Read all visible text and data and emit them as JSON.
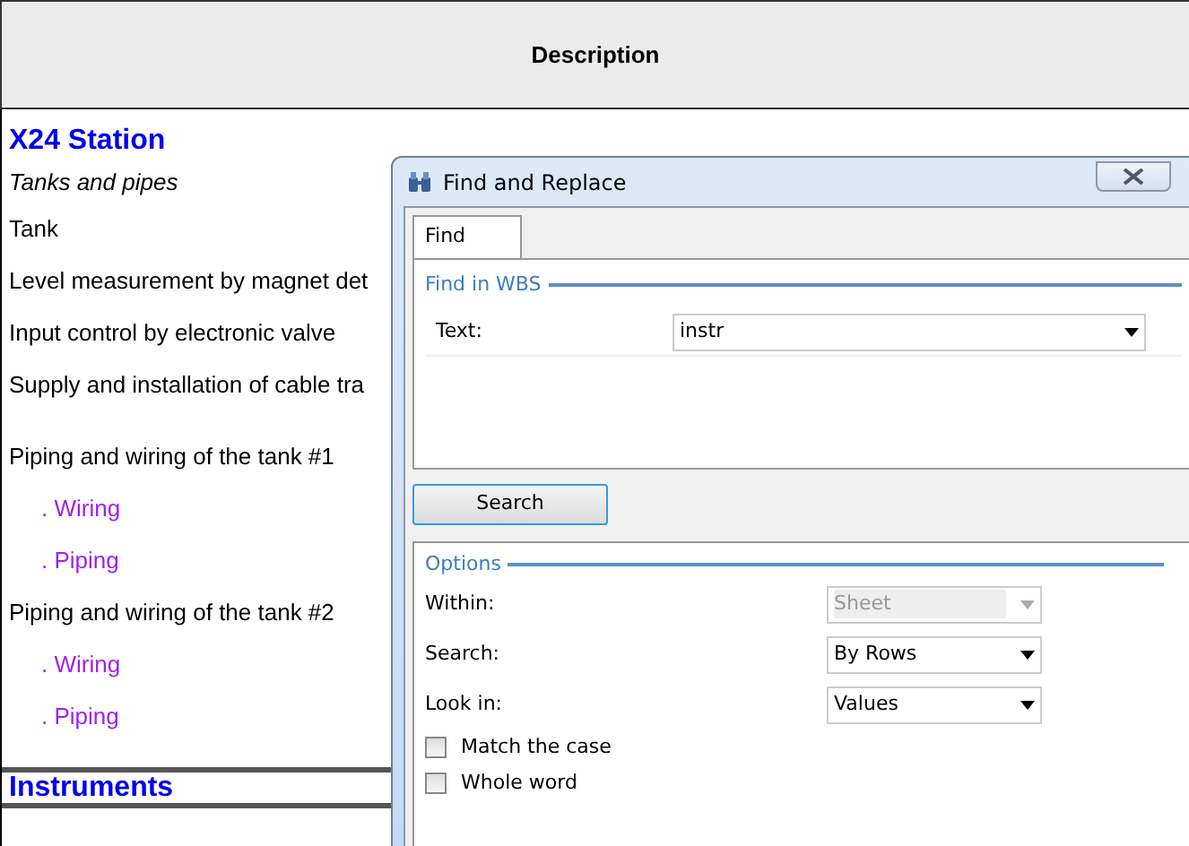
{
  "sheet": {
    "header": "Description",
    "rows": [
      {
        "kind": "title",
        "text": "X24 Station"
      },
      {
        "kind": "italic",
        "text": "Tanks and pipes"
      },
      {
        "kind": "text",
        "text": "Tank"
      },
      {
        "kind": "text",
        "text": "Level measurement by magnet det"
      },
      {
        "kind": "text",
        "text": "Input control by electronic valve"
      },
      {
        "kind": "text",
        "text": "Supply and installation of cable tra"
      },
      {
        "kind": "text",
        "text": "Piping and wiring of the tank #1"
      },
      {
        "kind": "sub",
        "text": ". Wiring"
      },
      {
        "kind": "sub",
        "text": ". Piping"
      },
      {
        "kind": "text",
        "text": "Piping and wiring of the tank #2"
      },
      {
        "kind": "sub",
        "text": ". Wiring"
      },
      {
        "kind": "sub",
        "text": ". Piping"
      },
      {
        "kind": "section",
        "text": "Instruments"
      }
    ]
  },
  "dialog": {
    "title": "Find and Replace",
    "tabs": [
      {
        "label": "Find",
        "selected": true
      }
    ],
    "find_group": {
      "title": "Find in WBS",
      "label": "Text:",
      "value": "instr"
    },
    "search_button": "Search",
    "options": {
      "title": "Options",
      "selects": [
        {
          "label": "Within:",
          "value": "Sheet",
          "disabled": true
        },
        {
          "label": "Search:",
          "value": "By Rows",
          "disabled": false
        },
        {
          "label": "Look in:",
          "value": "Values",
          "disabled": false
        }
      ],
      "checkboxes": [
        {
          "label": "Match the case",
          "checked": false
        },
        {
          "label": "Whole word",
          "checked": false
        }
      ]
    }
  }
}
